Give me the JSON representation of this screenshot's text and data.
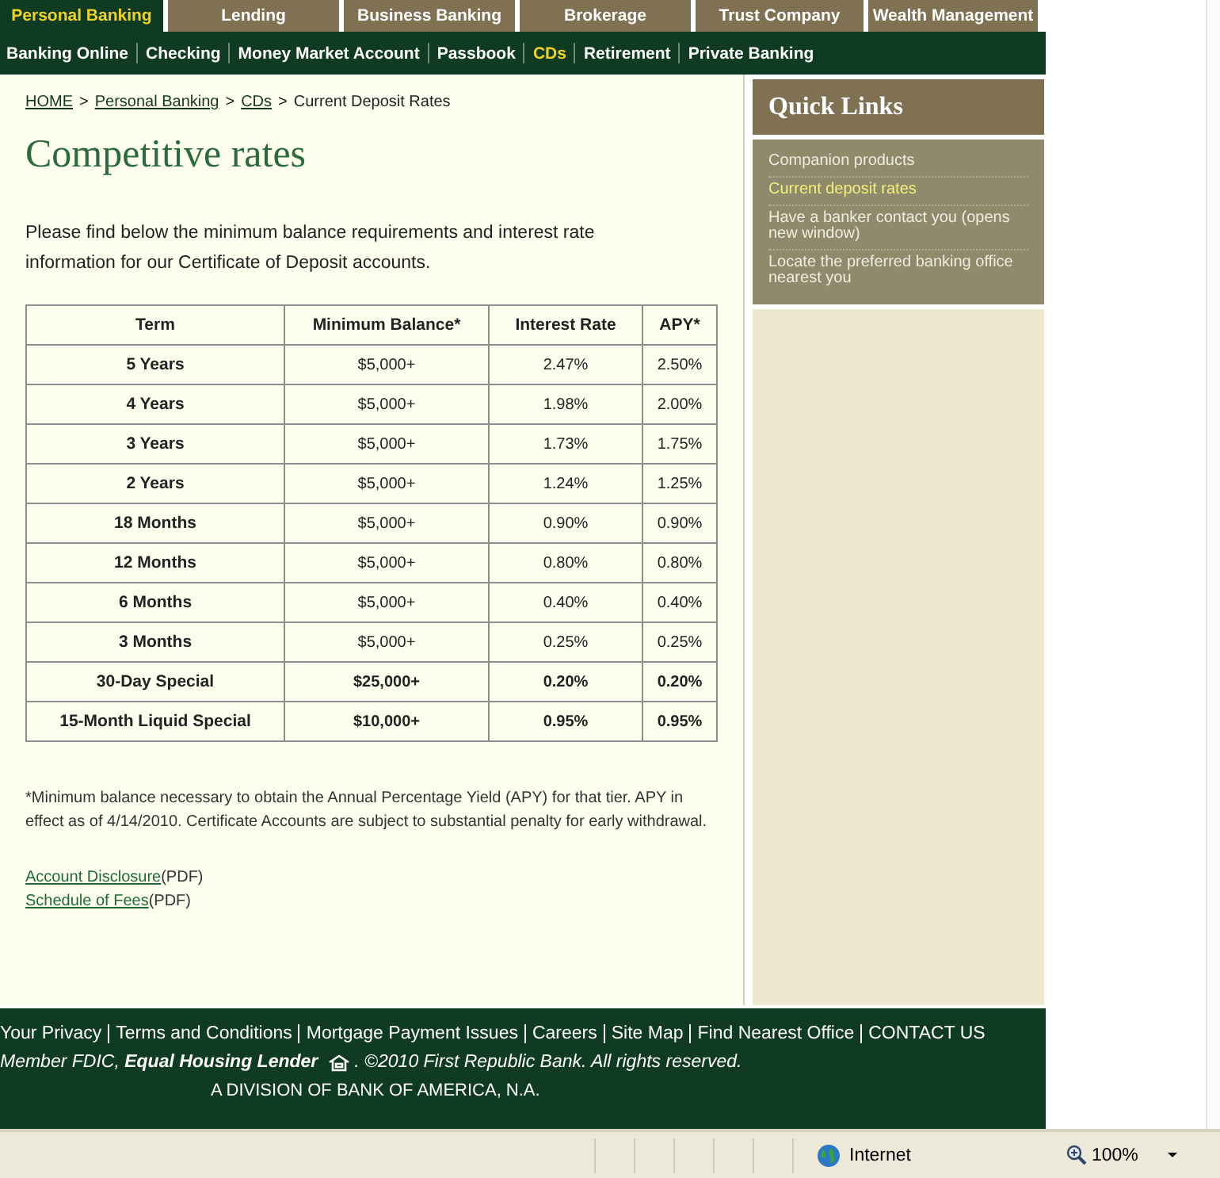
{
  "tabs": [
    {
      "label": "Personal Banking",
      "selected": true
    },
    {
      "label": "Lending",
      "selected": false
    },
    {
      "label": "Business Banking",
      "selected": false
    },
    {
      "label": "Brokerage",
      "selected": false
    },
    {
      "label": "Trust Company",
      "selected": false
    },
    {
      "label": "Wealth Management",
      "selected": false
    }
  ],
  "subnav": [
    {
      "label": "Banking Online",
      "selected": false
    },
    {
      "label": "Checking",
      "selected": false
    },
    {
      "label": "Money Market Account",
      "selected": false
    },
    {
      "label": "Passbook",
      "selected": false
    },
    {
      "label": "CDs",
      "selected": true
    },
    {
      "label": "Retirement",
      "selected": false
    },
    {
      "label": "Private Banking",
      "selected": false
    }
  ],
  "breadcrumb": [
    {
      "label": "HOME",
      "kind": "link"
    },
    {
      "label": ">",
      "kind": "separator"
    },
    {
      "label": "Personal Banking",
      "kind": "link"
    },
    {
      "label": ">",
      "kind": "separator"
    },
    {
      "label": "CDs",
      "kind": "link"
    },
    {
      "label": ">",
      "kind": "separator"
    },
    {
      "label": "Current Deposit Rates",
      "kind": "text"
    }
  ],
  "heading": "Competitive rates",
  "intro": "Please find below the minimum balance requirements and interest rate information for our Certificate of Deposit accounts.",
  "table": {
    "columns": [
      "Term",
      "Minimum Balance*",
      "Interest Rate",
      "APY*"
    ],
    "rows": [
      {
        "cells": [
          "5 Years",
          "$5,000+",
          "2.47%",
          "2.50%"
        ],
        "special": false
      },
      {
        "cells": [
          "4 Years",
          "$5,000+",
          "1.98%",
          "2.00%"
        ],
        "special": false
      },
      {
        "cells": [
          "3 Years",
          "$5,000+",
          "1.73%",
          "1.75%"
        ],
        "special": false
      },
      {
        "cells": [
          "2 Years",
          "$5,000+",
          "1.24%",
          "1.25%"
        ],
        "special": false
      },
      {
        "cells": [
          "18 Months",
          "$5,000+",
          "0.90%",
          "0.90%"
        ],
        "special": false
      },
      {
        "cells": [
          "12 Months",
          "$5,000+",
          "0.80%",
          "0.80%"
        ],
        "special": false
      },
      {
        "cells": [
          "6 Months",
          "$5,000+",
          "0.40%",
          "0.40%"
        ],
        "special": false
      },
      {
        "cells": [
          "3 Months",
          "$5,000+",
          "0.25%",
          "0.25%"
        ],
        "special": false
      },
      {
        "cells": [
          "30-Day Special",
          "$25,000+",
          "0.20%",
          "0.20%"
        ],
        "special": true
      },
      {
        "cells": [
          "15-Month Liquid Special",
          "$10,000+",
          "0.95%",
          "0.95%"
        ],
        "special": true
      }
    ]
  },
  "footnote": "*Minimum balance necessary to obtain the Annual Percentage Yield (APY) for that tier. APY in effect as of 4/14/2010. Certificate Accounts are subject to substantial penalty for early withdrawal.",
  "documents": [
    {
      "link": "Account Disclosure",
      "note": "(PDF)"
    },
    {
      "link": "Schedule of Fees",
      "note": "(PDF)"
    }
  ],
  "quick_links": {
    "title": "Quick Links",
    "items": [
      {
        "label": "Companion products",
        "selected": false
      },
      {
        "label": "Current deposit rates",
        "selected": true
      },
      {
        "label": "Have a banker contact you (opens new window)",
        "selected": false
      },
      {
        "label": "Locate the preferred banking office nearest you",
        "selected": false
      }
    ]
  },
  "footer": {
    "links": [
      "Your Privacy",
      "Terms and Conditions",
      "Mortgage Payment Issues",
      "Careers",
      "Site Map",
      "Find Nearest Office",
      "CONTACT US"
    ],
    "member": "Member FDIC, **Equal Housing Lender**",
    "copyright": ". ©2010 First Republic Bank. All rights reserved.",
    "division": "A DIVISION OF BANK OF AMERICA, N.A."
  },
  "status_bar": {
    "zone": "Internet",
    "zoom": "100%"
  }
}
